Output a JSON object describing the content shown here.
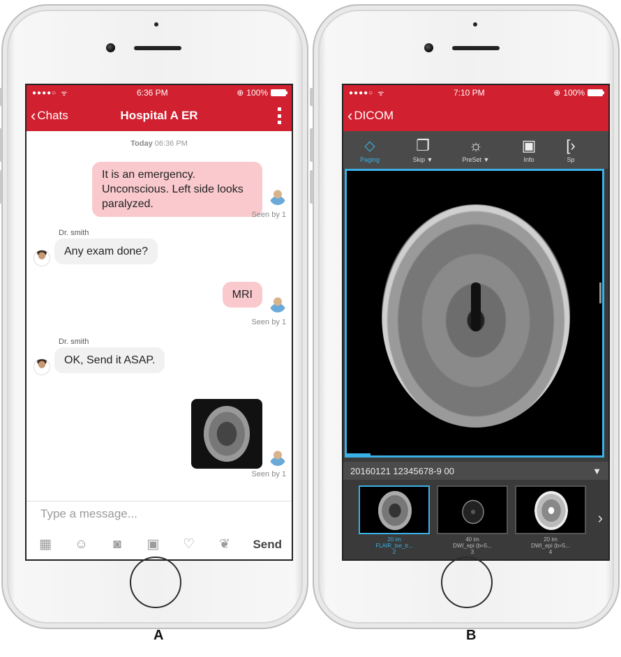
{
  "panel_a": {
    "label": "A",
    "status": {
      "carrier": "●●●●○",
      "time": "6:36 PM",
      "battery": "100%"
    },
    "nav": {
      "back_label": "Chats",
      "title": "Hospital A ER"
    },
    "chat": {
      "day_label": "Today",
      "day_time": "06:36 PM",
      "messages": [
        {
          "text": "It is an emergency. Unconscious. Left side looks paralyzed.",
          "seen": "Seen by 1"
        },
        {
          "sender": "Dr. smith",
          "text": "Any exam done?"
        },
        {
          "text": "MRI",
          "seen": "Seen by 1"
        },
        {
          "sender": "Dr. smith",
          "text": "OK, Send it ASAP."
        },
        {
          "seen": "Seen by 1"
        }
      ]
    },
    "composer": {
      "placeholder": "Type a message...",
      "send_label": "Send"
    }
  },
  "panel_b": {
    "label": "B",
    "status": {
      "carrier": "●●●●○",
      "time": "7:10 PM",
      "battery": "100%"
    },
    "nav": {
      "back_label": "DICOM"
    },
    "tools": [
      {
        "label": "Paging",
        "icon": "paging-icon"
      },
      {
        "label": "Skip ▼",
        "icon": "skip-icon"
      },
      {
        "label": "PreSet ▼",
        "icon": "preset-icon"
      },
      {
        "label": "Info",
        "icon": "info-icon"
      },
      {
        "label": "Sp",
        "icon": "split-icon"
      }
    ],
    "series_bar": {
      "text": "20160121 12345678-9 00",
      "toggle": "▼"
    },
    "thumbnails": [
      {
        "count": "20 im",
        "name": "FLAIR_tse_tr...",
        "number": "2"
      },
      {
        "count": "40 im",
        "name": "DWI_epi (b=5...",
        "number": "3"
      },
      {
        "count": "20 im",
        "name": "DWI_epi (b=5...",
        "number": "4"
      }
    ]
  },
  "colors": {
    "nav_red": "#d1202f",
    "outgoing_bubble": "#f9c9cd",
    "accent_blue": "#3ab1e6"
  }
}
